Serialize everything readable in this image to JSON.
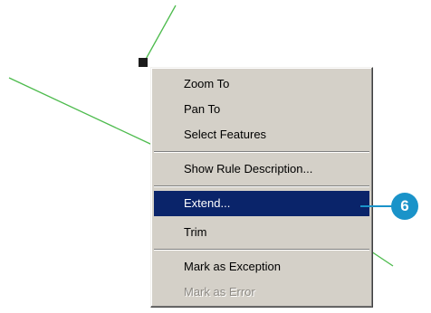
{
  "context_menu": {
    "items": [
      {
        "label": "Zoom To"
      },
      {
        "label": "Pan To"
      },
      {
        "label": "Select Features"
      },
      {
        "label": "Show Rule Description..."
      },
      {
        "label": "Extend..."
      },
      {
        "label": "Trim"
      },
      {
        "label": "Mark as Exception"
      },
      {
        "label": "Mark as Error"
      }
    ],
    "selected_item": "Extend...",
    "disabled_item": "Mark as Error"
  },
  "callout": {
    "number": "6",
    "color": "#1a93c9"
  },
  "colors": {
    "feature_line": "#4dbb4d",
    "selection_highlight": "#0a246a",
    "menu_background": "#d4d0c8",
    "vertex_marker": "#1c1c1c"
  }
}
